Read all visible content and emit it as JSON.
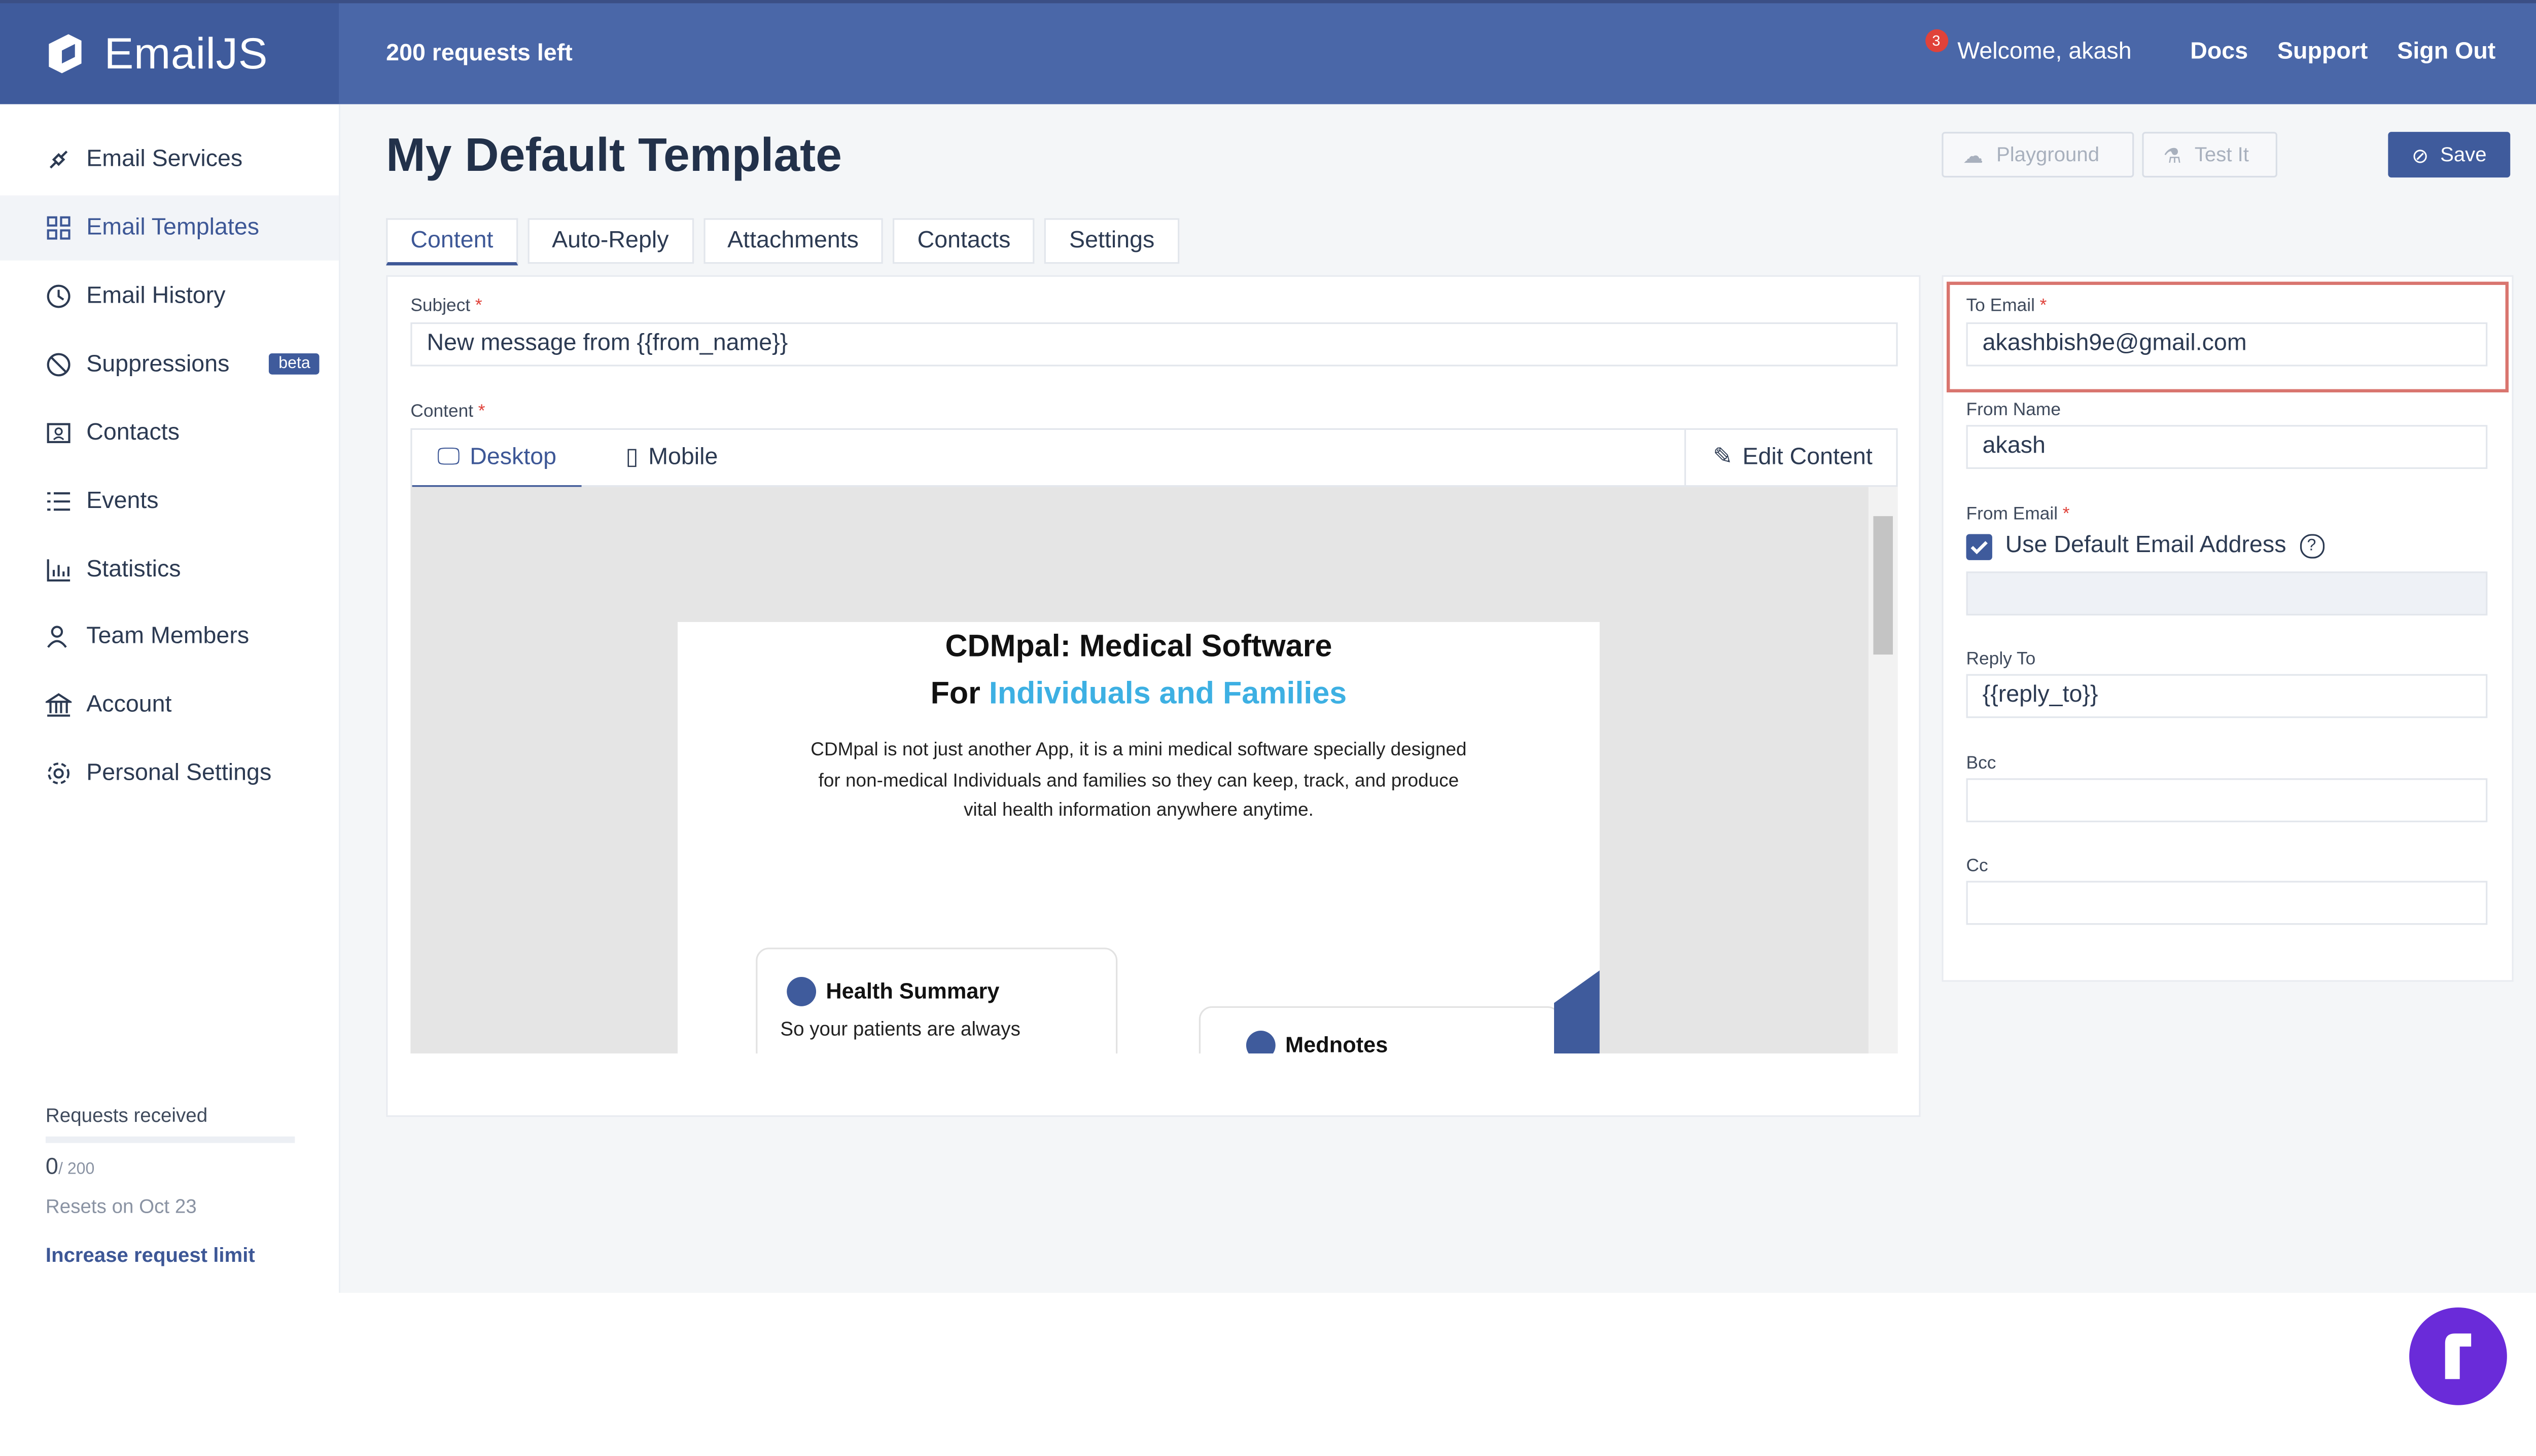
{
  "header": {
    "brand": "EmailJS",
    "requests_left": "200 requests left",
    "notification_count": "3",
    "welcome": "Welcome,  akash",
    "links": [
      "Docs",
      "Support",
      "Sign Out"
    ]
  },
  "sidebar": {
    "items": [
      {
        "label": "Email Services",
        "icon": "plug-icon"
      },
      {
        "label": "Email Templates",
        "icon": "grid-icon",
        "active": true
      },
      {
        "label": "Email History",
        "icon": "history-icon"
      },
      {
        "label": "Suppressions",
        "icon": "ban-icon",
        "badge": "beta"
      },
      {
        "label": "Contacts",
        "icon": "contact-card-icon"
      },
      {
        "label": "Events",
        "icon": "list-icon"
      },
      {
        "label": "Statistics",
        "icon": "bar-chart-icon"
      },
      {
        "label": "Team Members",
        "icon": "users-icon"
      },
      {
        "label": "Account",
        "icon": "bank-icon"
      },
      {
        "label": "Personal Settings",
        "icon": "gear-icon"
      }
    ],
    "usage": {
      "title": "Requests received",
      "count": "0",
      "limit": "/ 200",
      "progress": 0,
      "reset": "Resets on Oct 23",
      "increase": "Increase request limit"
    }
  },
  "main": {
    "title": "My Default Template",
    "buttons": {
      "playground": "Playground",
      "test": "Test It",
      "save": "Save"
    },
    "tabs": [
      "Content",
      "Auto-Reply",
      "Attachments",
      "Contacts",
      "Settings"
    ],
    "subject_label": "Subject",
    "subject_value": "New message from {{from_name}}",
    "content_label": "Content",
    "editor_tabs": {
      "desktop": "Desktop",
      "mobile": "Mobile",
      "edit": "Edit Content"
    },
    "preview": {
      "headline_1": "CDMpal: Medical Software",
      "headline_2_prefix": "For ",
      "headline_2_accent": "Individuals and Families",
      "body": "CDMpal is not just another App, it is a mini medical software specially designed for non-medical Individuals and families so they can keep, track, and produce vital health information anywhere anytime.",
      "feature_1_title": "Health Summary",
      "feature_1_text": "So your patients are always",
      "feature_2_title": "Mednotes"
    }
  },
  "settings_panel": {
    "to_email_label": "To Email",
    "to_email_value": "akashbish9e@gmail.com",
    "from_name_label": "From Name",
    "from_name_value": "akash",
    "from_email_label": "From Email",
    "use_default_label": "Use Default Email Address",
    "use_default_checked": true,
    "reply_to_label": "Reply To",
    "reply_to_value": "{{reply_to}}",
    "bcc_label": "Bcc",
    "cc_label": "Cc"
  },
  "colors": {
    "brand": "#4a67a8",
    "accent": "#3db0e3",
    "highlight": "#d9756f",
    "danger": "#e0423a"
  }
}
